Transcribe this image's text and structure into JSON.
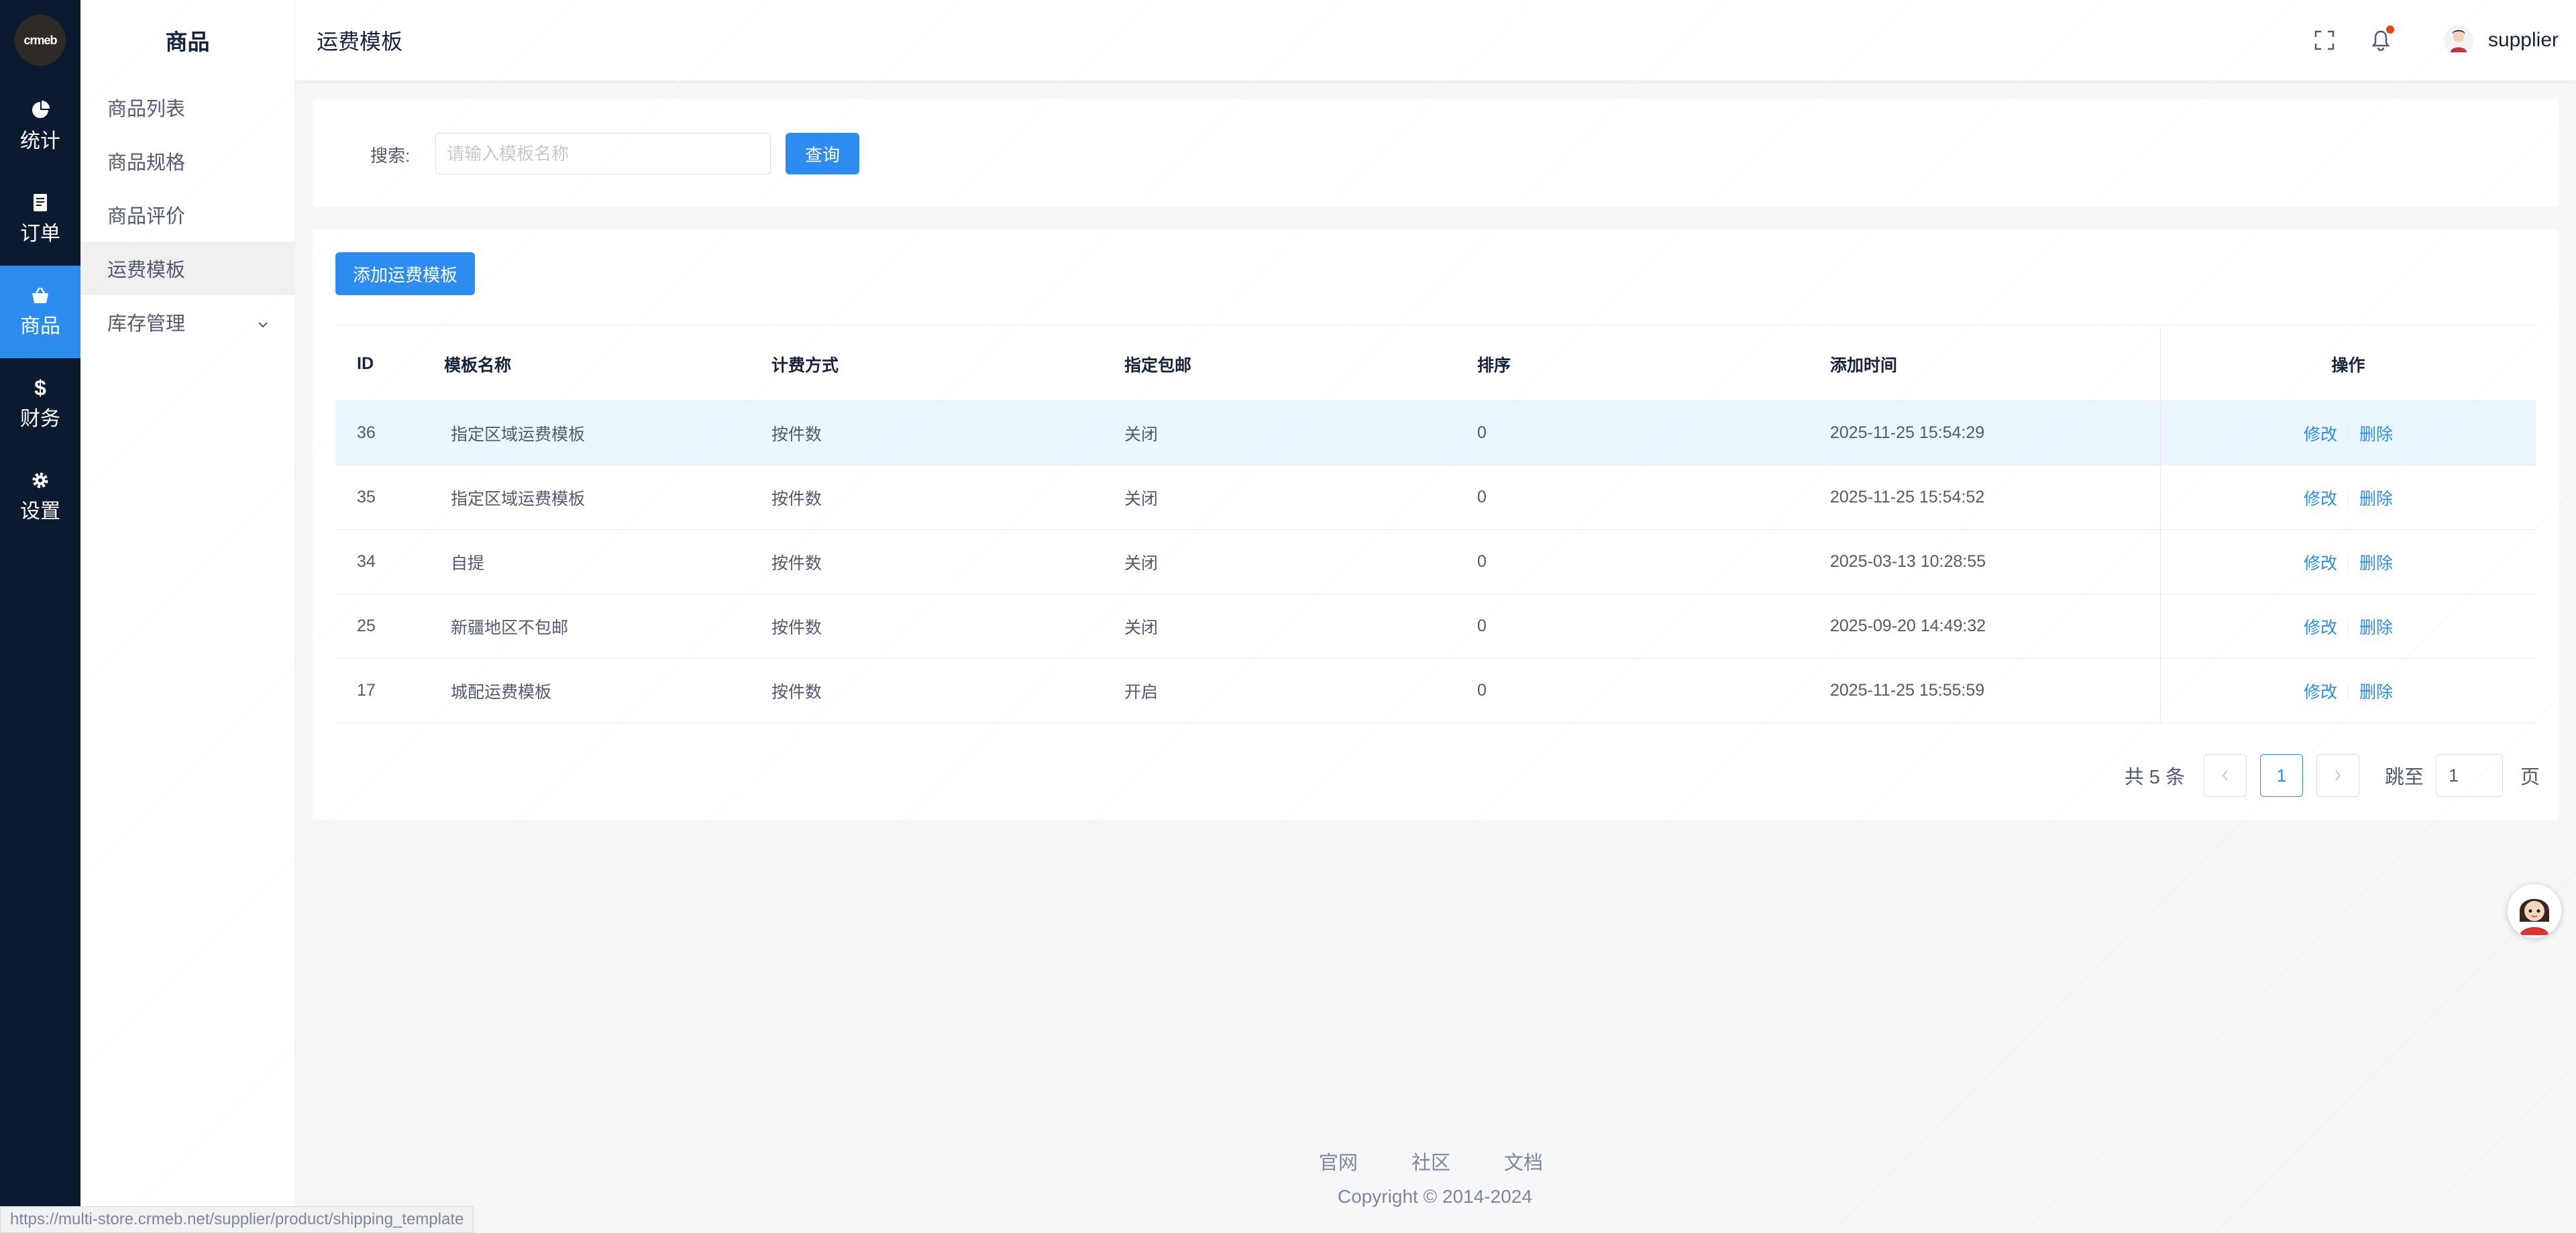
{
  "logo": {
    "text": "crmeb"
  },
  "main_menu": [
    {
      "label": "统计",
      "icon": "chart-pie-icon",
      "active": false
    },
    {
      "label": "订单",
      "icon": "order-doc-icon",
      "active": false
    },
    {
      "label": "商品",
      "icon": "shop-bag-icon",
      "active": true
    },
    {
      "label": "财务",
      "icon": "dollar-icon",
      "active": false
    },
    {
      "label": "设置",
      "icon": "gear-icon",
      "active": false
    }
  ],
  "sub_menu": {
    "title": "商品",
    "items": [
      {
        "label": "商品列表"
      },
      {
        "label": "商品规格"
      },
      {
        "label": "商品评价"
      },
      {
        "label": "运费模板"
      },
      {
        "label": "库存管理"
      }
    ]
  },
  "header": {
    "title": "运费模板",
    "username": "supplier",
    "icons": [
      "fullscreen-icon",
      "bell-icon"
    ]
  },
  "search": {
    "label": "搜索:",
    "placeholder": "请输入模板名称",
    "button": "查询"
  },
  "toolbar": {
    "add_label": "添加运费模板"
  },
  "table": {
    "columns": [
      "ID",
      "模板名称",
      "计费方式",
      "指定包邮",
      "排序",
      "添加时间",
      "操作"
    ],
    "rows": [
      {
        "id": "36",
        "name": "指定区域运费模板",
        "fee": "按件数",
        "free": "关闭",
        "sort": "0",
        "time": "2025-11-25 15:54:29"
      },
      {
        "id": "35",
        "name": "指定区域运费模板",
        "fee": "按件数",
        "free": "关闭",
        "sort": "0",
        "time": "2025-11-25 15:54:52"
      },
      {
        "id": "34",
        "name": "自提",
        "fee": "按件数",
        "free": "关闭",
        "sort": "0",
        "time": "2025-03-13 10:28:55"
      },
      {
        "id": "25",
        "name": "新疆地区不包邮",
        "fee": "按件数",
        "free": "关闭",
        "sort": "0",
        "time": "2025-09-20 14:49:32"
      },
      {
        "id": "17",
        "name": "城配运费模板",
        "fee": "按件数",
        "free": "开启",
        "sort": "0",
        "time": "2025-11-25 15:55:59"
      }
    ],
    "edit_label": "修改",
    "delete_label": "删除"
  },
  "pagination": {
    "total_text": "共 5 条",
    "current_page": "1",
    "jump_label": "跳至",
    "jump_value": "1",
    "unit": "页"
  },
  "footer": {
    "links": [
      "官网",
      "社区",
      "文档"
    ],
    "copyright": "Copyright © 2014-2024"
  },
  "status_url": "https://multi-store.crmeb.net/supplier/product/shipping_template",
  "colors": {
    "primary": "#2d8cf0",
    "sidebar_bg": "#0b1a2e",
    "alert": "#ed4014"
  }
}
